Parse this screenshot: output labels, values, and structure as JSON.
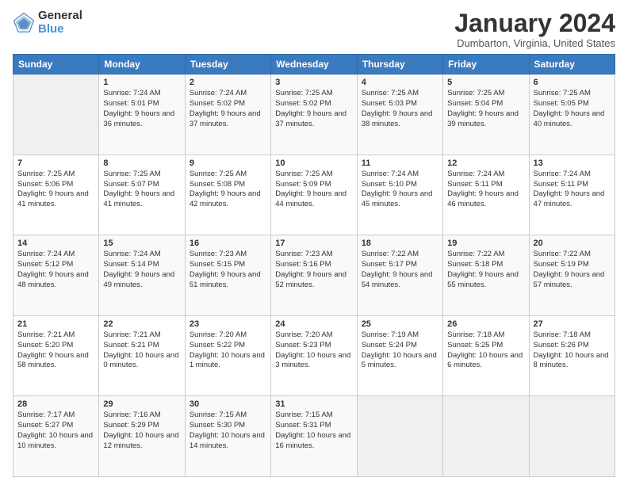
{
  "logo": {
    "general": "General",
    "blue": "Blue"
  },
  "header": {
    "month": "January 2024",
    "location": "Dumbarton, Virginia, United States"
  },
  "weekdays": [
    "Sunday",
    "Monday",
    "Tuesday",
    "Wednesday",
    "Thursday",
    "Friday",
    "Saturday"
  ],
  "weeks": [
    [
      {
        "day": "",
        "empty": true
      },
      {
        "day": "1",
        "sunrise": "7:24 AM",
        "sunset": "5:01 PM",
        "daylight": "9 hours and 36 minutes."
      },
      {
        "day": "2",
        "sunrise": "7:24 AM",
        "sunset": "5:02 PM",
        "daylight": "9 hours and 37 minutes."
      },
      {
        "day": "3",
        "sunrise": "7:25 AM",
        "sunset": "5:02 PM",
        "daylight": "9 hours and 37 minutes."
      },
      {
        "day": "4",
        "sunrise": "7:25 AM",
        "sunset": "5:03 PM",
        "daylight": "9 hours and 38 minutes."
      },
      {
        "day": "5",
        "sunrise": "7:25 AM",
        "sunset": "5:04 PM",
        "daylight": "9 hours and 39 minutes."
      },
      {
        "day": "6",
        "sunrise": "7:25 AM",
        "sunset": "5:05 PM",
        "daylight": "9 hours and 40 minutes."
      }
    ],
    [
      {
        "day": "7",
        "sunrise": "7:25 AM",
        "sunset": "5:06 PM",
        "daylight": "9 hours and 41 minutes."
      },
      {
        "day": "8",
        "sunrise": "7:25 AM",
        "sunset": "5:07 PM",
        "daylight": "9 hours and 41 minutes."
      },
      {
        "day": "9",
        "sunrise": "7:25 AM",
        "sunset": "5:08 PM",
        "daylight": "9 hours and 42 minutes."
      },
      {
        "day": "10",
        "sunrise": "7:25 AM",
        "sunset": "5:09 PM",
        "daylight": "9 hours and 44 minutes."
      },
      {
        "day": "11",
        "sunrise": "7:24 AM",
        "sunset": "5:10 PM",
        "daylight": "9 hours and 45 minutes."
      },
      {
        "day": "12",
        "sunrise": "7:24 AM",
        "sunset": "5:11 PM",
        "daylight": "9 hours and 46 minutes."
      },
      {
        "day": "13",
        "sunrise": "7:24 AM",
        "sunset": "5:11 PM",
        "daylight": "9 hours and 47 minutes."
      }
    ],
    [
      {
        "day": "14",
        "sunrise": "7:24 AM",
        "sunset": "5:12 PM",
        "daylight": "9 hours and 48 minutes."
      },
      {
        "day": "15",
        "sunrise": "7:24 AM",
        "sunset": "5:14 PM",
        "daylight": "9 hours and 49 minutes."
      },
      {
        "day": "16",
        "sunrise": "7:23 AM",
        "sunset": "5:15 PM",
        "daylight": "9 hours and 51 minutes."
      },
      {
        "day": "17",
        "sunrise": "7:23 AM",
        "sunset": "5:16 PM",
        "daylight": "9 hours and 52 minutes."
      },
      {
        "day": "18",
        "sunrise": "7:22 AM",
        "sunset": "5:17 PM",
        "daylight": "9 hours and 54 minutes."
      },
      {
        "day": "19",
        "sunrise": "7:22 AM",
        "sunset": "5:18 PM",
        "daylight": "9 hours and 55 minutes."
      },
      {
        "day": "20",
        "sunrise": "7:22 AM",
        "sunset": "5:19 PM",
        "daylight": "9 hours and 57 minutes."
      }
    ],
    [
      {
        "day": "21",
        "sunrise": "7:21 AM",
        "sunset": "5:20 PM",
        "daylight": "9 hours and 58 minutes."
      },
      {
        "day": "22",
        "sunrise": "7:21 AM",
        "sunset": "5:21 PM",
        "daylight": "10 hours and 0 minutes."
      },
      {
        "day": "23",
        "sunrise": "7:20 AM",
        "sunset": "5:22 PM",
        "daylight": "10 hours and 1 minute."
      },
      {
        "day": "24",
        "sunrise": "7:20 AM",
        "sunset": "5:23 PM",
        "daylight": "10 hours and 3 minutes."
      },
      {
        "day": "25",
        "sunrise": "7:19 AM",
        "sunset": "5:24 PM",
        "daylight": "10 hours and 5 minutes."
      },
      {
        "day": "26",
        "sunrise": "7:18 AM",
        "sunset": "5:25 PM",
        "daylight": "10 hours and 6 minutes."
      },
      {
        "day": "27",
        "sunrise": "7:18 AM",
        "sunset": "5:26 PM",
        "daylight": "10 hours and 8 minutes."
      }
    ],
    [
      {
        "day": "28",
        "sunrise": "7:17 AM",
        "sunset": "5:27 PM",
        "daylight": "10 hours and 10 minutes."
      },
      {
        "day": "29",
        "sunrise": "7:16 AM",
        "sunset": "5:29 PM",
        "daylight": "10 hours and 12 minutes."
      },
      {
        "day": "30",
        "sunrise": "7:15 AM",
        "sunset": "5:30 PM",
        "daylight": "10 hours and 14 minutes."
      },
      {
        "day": "31",
        "sunrise": "7:15 AM",
        "sunset": "5:31 PM",
        "daylight": "10 hours and 16 minutes."
      },
      {
        "day": "",
        "empty": true
      },
      {
        "day": "",
        "empty": true
      },
      {
        "day": "",
        "empty": true
      }
    ]
  ],
  "labels": {
    "sunrise_prefix": "Sunrise: ",
    "sunset_prefix": "Sunset: ",
    "daylight_prefix": "Daylight: "
  }
}
